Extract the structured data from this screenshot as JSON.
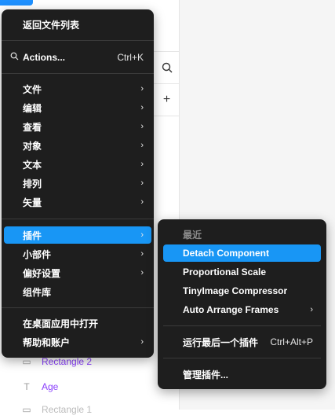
{
  "layers": [
    {
      "label": "Rectangle 2",
      "icon": "rectangle-icon"
    },
    {
      "label": "Age",
      "icon": "text-icon"
    },
    {
      "label": "Rectangle 1",
      "icon": "rectangle-icon"
    }
  ],
  "toolbar": {
    "search_icon": "⌕",
    "add_icon": "+"
  },
  "main_menu": {
    "back": "返回文件列表",
    "actions": {
      "label": "Actions...",
      "shortcut": "Ctrl+K"
    },
    "group1": [
      "文件",
      "编辑",
      "查看",
      "对象",
      "文本",
      "排列",
      "矢量"
    ],
    "group2": [
      {
        "label": "插件",
        "arrow": "›"
      },
      {
        "label": "小部件",
        "arrow": "›"
      },
      {
        "label": "偏好设置",
        "arrow": "›"
      },
      {
        "label": "组件库",
        "arrow": ""
      }
    ],
    "group3": [
      {
        "label": "在桌面应用中打开",
        "arrow": ""
      },
      {
        "label": "帮助和账户",
        "arrow": "›"
      }
    ],
    "arrow": "›"
  },
  "sub_menu": {
    "header": "最近",
    "recent": [
      {
        "label": "Detach Component",
        "arrow": ""
      },
      {
        "label": "Proportional Scale",
        "arrow": ""
      },
      {
        "label": "TinyImage Compressor",
        "arrow": ""
      },
      {
        "label": "Auto Arrange Frames",
        "arrow": "›"
      }
    ],
    "run_last": {
      "label": "运行最后一个插件",
      "shortcut": "Ctrl+Alt+P"
    },
    "manage": "管理插件..."
  },
  "colors": {
    "accent": "#1896f5",
    "menu_bg": "#1e1e1e",
    "layer_purple": "#8a3ffc"
  }
}
